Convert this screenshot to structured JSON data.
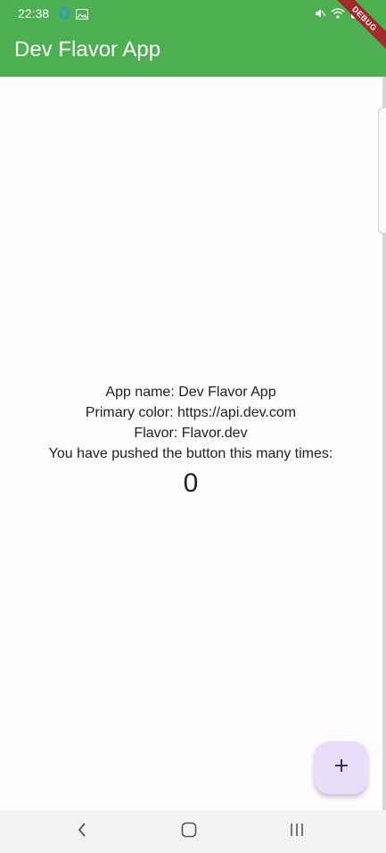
{
  "status_bar": {
    "time": "22:38",
    "left_icons": [
      "sync-icon",
      "image-icon"
    ],
    "right_icons": [
      "mute-icon",
      "wifi-icon",
      "battery-icon"
    ]
  },
  "debug_banner": {
    "label": "DEBUG"
  },
  "app_bar": {
    "title": "Dev Flavor App",
    "color": "#4caf50"
  },
  "body": {
    "lines": [
      "App name: Dev Flavor App",
      "Primary color: https://api.dev.com",
      "Flavor: Flavor.dev",
      "You have pushed the button this many times:"
    ],
    "counter": "0"
  },
  "fab": {
    "icon": "plus-icon",
    "color": "#e8defa"
  },
  "nav_bar": {
    "buttons": [
      "back-icon",
      "home-icon",
      "recents-icon"
    ]
  }
}
